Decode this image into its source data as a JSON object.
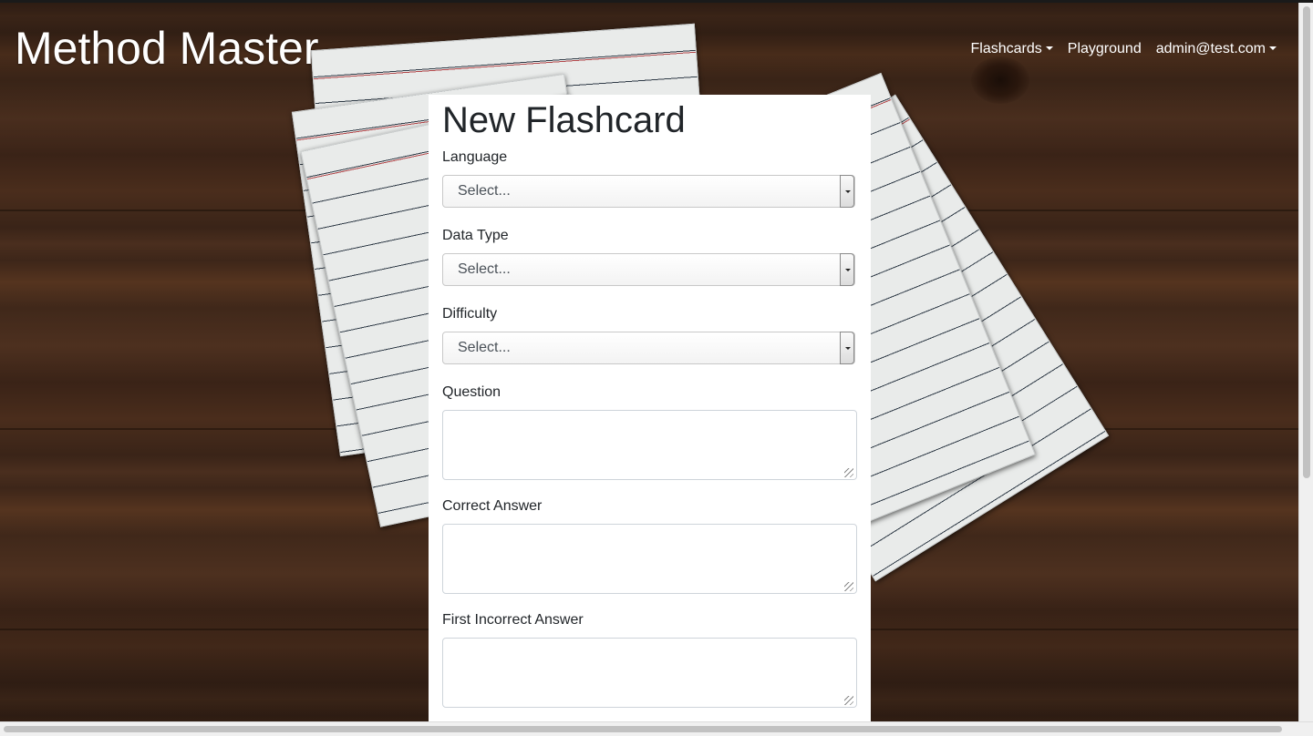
{
  "app": {
    "brand": "Method Master"
  },
  "nav": {
    "flashcards_label": "Flashcards",
    "playground_label": "Playground",
    "user_label": "admin@test.com"
  },
  "form": {
    "title": "New Flashcard",
    "language": {
      "label": "Language",
      "value": "Select..."
    },
    "data_type": {
      "label": "Data Type",
      "value": "Select..."
    },
    "difficulty": {
      "label": "Difficulty",
      "value": "Select..."
    },
    "question": {
      "label": "Question",
      "value": ""
    },
    "correct_answer": {
      "label": "Correct Answer",
      "value": ""
    },
    "first_incorrect_answer": {
      "label": "First Incorrect Answer",
      "value": ""
    }
  }
}
